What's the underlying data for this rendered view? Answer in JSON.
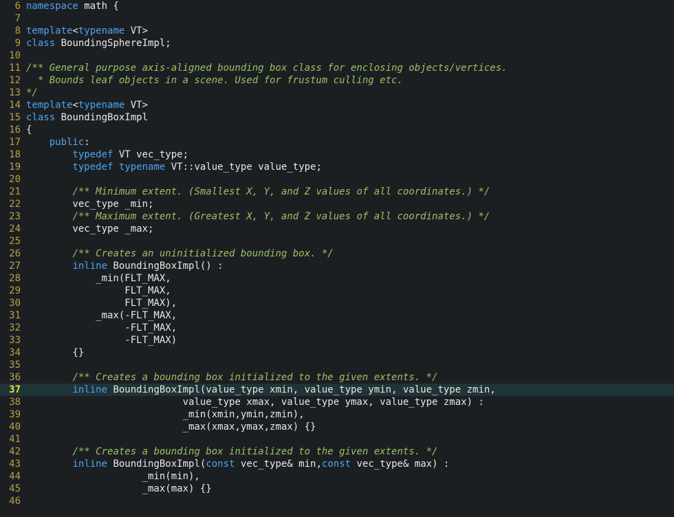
{
  "editor": {
    "current_line": 37,
    "colors": {
      "background": "#1c1f22",
      "current_line_bg": "#1f3436",
      "line_number": "#b6a341",
      "keyword": "#4ea3f0",
      "comment": "#9ac265",
      "text": "#e8e8e8"
    },
    "lines": [
      {
        "num": "6",
        "tokens": [
          {
            "t": "kw",
            "v": "namespace"
          },
          {
            "t": "plain",
            "v": " math {"
          }
        ]
      },
      {
        "num": "7",
        "tokens": []
      },
      {
        "num": "8",
        "tokens": [
          {
            "t": "kw",
            "v": "template"
          },
          {
            "t": "plain",
            "v": "<"
          },
          {
            "t": "kw",
            "v": "typename"
          },
          {
            "t": "plain",
            "v": " VT>"
          }
        ]
      },
      {
        "num": "9",
        "tokens": [
          {
            "t": "kw",
            "v": "class"
          },
          {
            "t": "plain",
            "v": " BoundingSphereImpl;"
          }
        ]
      },
      {
        "num": "10",
        "tokens": []
      },
      {
        "num": "11",
        "tokens": [
          {
            "t": "comment",
            "v": "/** General purpose axis-aligned bounding box class for enclosing objects/vertices."
          }
        ]
      },
      {
        "num": "12",
        "tokens": [
          {
            "t": "comment",
            "v": "  * Bounds leaf objects in a scene. Used for frustum culling etc."
          }
        ]
      },
      {
        "num": "13",
        "tokens": [
          {
            "t": "comment",
            "v": "*/"
          }
        ]
      },
      {
        "num": "14",
        "tokens": [
          {
            "t": "kw",
            "v": "template"
          },
          {
            "t": "plain",
            "v": "<"
          },
          {
            "t": "kw",
            "v": "typename"
          },
          {
            "t": "plain",
            "v": " VT>"
          }
        ]
      },
      {
        "num": "15",
        "tokens": [
          {
            "t": "kw",
            "v": "class"
          },
          {
            "t": "plain",
            "v": " BoundingBoxImpl"
          }
        ]
      },
      {
        "num": "16",
        "tokens": [
          {
            "t": "plain",
            "v": "{"
          }
        ]
      },
      {
        "num": "17",
        "tokens": [
          {
            "t": "plain",
            "v": "    "
          },
          {
            "t": "kw",
            "v": "public"
          },
          {
            "t": "plain",
            "v": ":"
          }
        ]
      },
      {
        "num": "18",
        "tokens": [
          {
            "t": "plain",
            "v": "        "
          },
          {
            "t": "kw",
            "v": "typedef"
          },
          {
            "t": "plain",
            "v": " VT vec_type;"
          }
        ]
      },
      {
        "num": "19",
        "tokens": [
          {
            "t": "plain",
            "v": "        "
          },
          {
            "t": "kw",
            "v": "typedef"
          },
          {
            "t": "plain",
            "v": " "
          },
          {
            "t": "kw",
            "v": "typename"
          },
          {
            "t": "plain",
            "v": " VT::value_type value_type;"
          }
        ]
      },
      {
        "num": "20",
        "tokens": []
      },
      {
        "num": "21",
        "tokens": [
          {
            "t": "plain",
            "v": "        "
          },
          {
            "t": "comment",
            "v": "/** Minimum extent. (Smallest X, Y, and Z values of all coordinates.) */"
          }
        ]
      },
      {
        "num": "22",
        "tokens": [
          {
            "t": "plain",
            "v": "        vec_type _min;"
          }
        ]
      },
      {
        "num": "23",
        "tokens": [
          {
            "t": "plain",
            "v": "        "
          },
          {
            "t": "comment",
            "v": "/** Maximum extent. (Greatest X, Y, and Z values of all coordinates.) */"
          }
        ]
      },
      {
        "num": "24",
        "tokens": [
          {
            "t": "plain",
            "v": "        vec_type _max;"
          }
        ]
      },
      {
        "num": "25",
        "tokens": []
      },
      {
        "num": "26",
        "tokens": [
          {
            "t": "plain",
            "v": "        "
          },
          {
            "t": "comment",
            "v": "/** Creates an uninitialized bounding box. */"
          }
        ]
      },
      {
        "num": "27",
        "tokens": [
          {
            "t": "plain",
            "v": "        "
          },
          {
            "t": "kw",
            "v": "inline"
          },
          {
            "t": "plain",
            "v": " BoundingBoxImpl() :"
          }
        ]
      },
      {
        "num": "28",
        "tokens": [
          {
            "t": "plain",
            "v": "            _min(FLT_MAX,"
          }
        ]
      },
      {
        "num": "29",
        "tokens": [
          {
            "t": "plain",
            "v": "                 FLT_MAX,"
          }
        ]
      },
      {
        "num": "30",
        "tokens": [
          {
            "t": "plain",
            "v": "                 FLT_MAX),"
          }
        ]
      },
      {
        "num": "31",
        "tokens": [
          {
            "t": "plain",
            "v": "            _max(-FLT_MAX,"
          }
        ]
      },
      {
        "num": "32",
        "tokens": [
          {
            "t": "plain",
            "v": "                 -FLT_MAX,"
          }
        ]
      },
      {
        "num": "33",
        "tokens": [
          {
            "t": "plain",
            "v": "                 -FLT_MAX)"
          }
        ]
      },
      {
        "num": "34",
        "tokens": [
          {
            "t": "plain",
            "v": "        {}"
          }
        ]
      },
      {
        "num": "35",
        "tokens": []
      },
      {
        "num": "36",
        "tokens": [
          {
            "t": "plain",
            "v": "        "
          },
          {
            "t": "comment",
            "v": "/** Creates a bounding box initialized to the given extents. */"
          }
        ]
      },
      {
        "num": "37",
        "tokens": [
          {
            "t": "plain",
            "v": "        "
          },
          {
            "t": "kw",
            "v": "inline"
          },
          {
            "t": "plain",
            "v": " BoundingBoxImpl(value_type xmin, value_type ymin, value_type zmin,"
          }
        ]
      },
      {
        "num": "38",
        "tokens": [
          {
            "t": "plain",
            "v": "                           value_type xmax, value_type ymax, value_type zmax) :"
          }
        ]
      },
      {
        "num": "39",
        "tokens": [
          {
            "t": "plain",
            "v": "                           _min(xmin,ymin,zmin),"
          }
        ]
      },
      {
        "num": "40",
        "tokens": [
          {
            "t": "plain",
            "v": "                           _max(xmax,ymax,zmax) {}"
          }
        ]
      },
      {
        "num": "41",
        "tokens": []
      },
      {
        "num": "42",
        "tokens": [
          {
            "t": "plain",
            "v": "        "
          },
          {
            "t": "comment",
            "v": "/** Creates a bounding box initialized to the given extents. */"
          }
        ]
      },
      {
        "num": "43",
        "tokens": [
          {
            "t": "plain",
            "v": "        "
          },
          {
            "t": "kw",
            "v": "inline"
          },
          {
            "t": "plain",
            "v": " BoundingBoxImpl("
          },
          {
            "t": "kw",
            "v": "const"
          },
          {
            "t": "plain",
            "v": " vec_type& min,"
          },
          {
            "t": "kw",
            "v": "const"
          },
          {
            "t": "plain",
            "v": " vec_type& max) :"
          }
        ]
      },
      {
        "num": "44",
        "tokens": [
          {
            "t": "plain",
            "v": "                    _min(min),"
          }
        ]
      },
      {
        "num": "45",
        "tokens": [
          {
            "t": "plain",
            "v": "                    _max(max) {}"
          }
        ]
      },
      {
        "num": "46",
        "tokens": []
      }
    ]
  }
}
